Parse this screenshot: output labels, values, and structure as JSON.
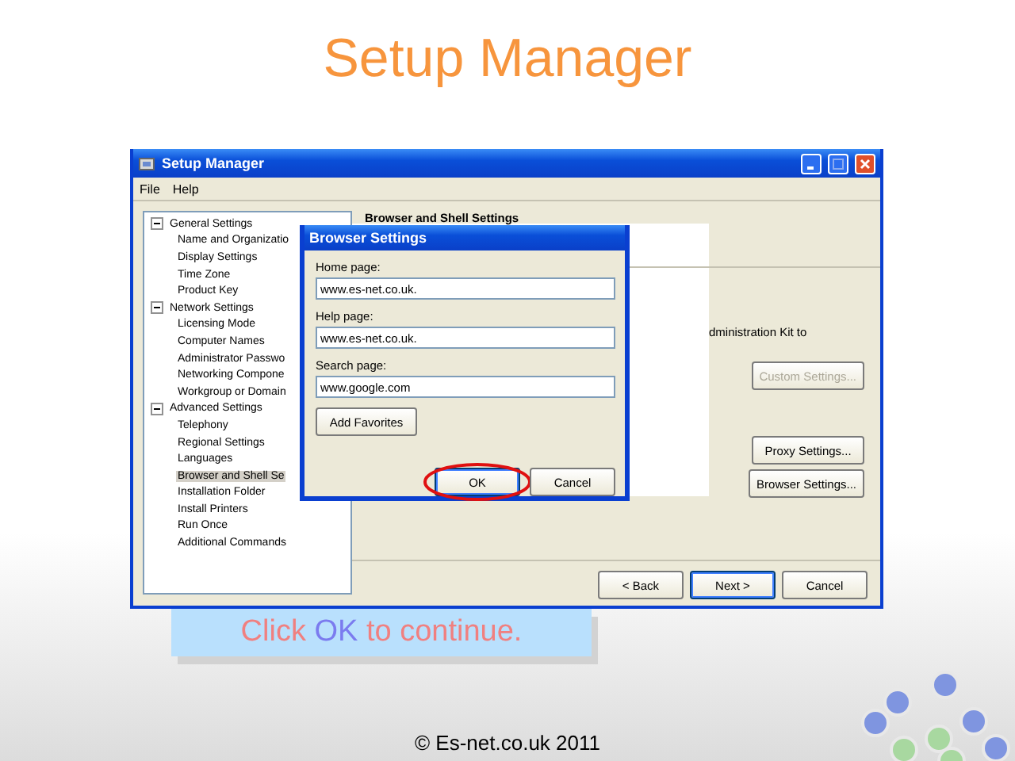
{
  "slide": {
    "title": "Setup Manager",
    "footer": "© Es-net.co.uk 2011"
  },
  "window": {
    "title": "Setup Manager",
    "menu": [
      "File",
      "Help"
    ],
    "tree": [
      {
        "label": "General Settings",
        "expanded": true,
        "selected": false,
        "children": [
          {
            "label": "Name and Organizatio",
            "selected": false
          },
          {
            "label": "Display Settings",
            "selected": false
          },
          {
            "label": "Time Zone",
            "selected": false
          },
          {
            "label": "Product Key",
            "selected": false
          }
        ]
      },
      {
        "label": "Network Settings",
        "expanded": true,
        "selected": false,
        "children": [
          {
            "label": "Licensing Mode",
            "selected": false
          },
          {
            "label": "Computer Names",
            "selected": false
          },
          {
            "label": "Administrator Passwo",
            "selected": false
          },
          {
            "label": "Networking Compone",
            "selected": false
          },
          {
            "label": "Workgroup or Domain",
            "selected": false
          }
        ]
      },
      {
        "label": "Advanced Settings",
        "expanded": true,
        "selected": false,
        "children": [
          {
            "label": "Telephony",
            "selected": false
          },
          {
            "label": "Regional Settings",
            "selected": false
          },
          {
            "label": "Languages",
            "selected": false
          },
          {
            "label": "Browser and Shell Se",
            "selected": true
          },
          {
            "label": "Installation Folder",
            "selected": false
          },
          {
            "label": "Install Printers",
            "selected": false
          },
          {
            "label": "Run Once",
            "selected": false
          },
          {
            "label": "Additional Commands",
            "selected": false
          }
        ]
      }
    ],
    "page_title": "Browser and Shell Settings",
    "text": "dministration Kit to",
    "buttons": [
      {
        "label": "Custom Settings...",
        "disabled": true
      },
      {
        "label": "Proxy Settings...",
        "disabled": false
      },
      {
        "label": "Browser Settings...",
        "disabled": false
      }
    ],
    "nav_buttons": [
      {
        "label": "< Back",
        "default": false
      },
      {
        "label": "Next >",
        "default": true
      },
      {
        "label": "Cancel",
        "default": false
      }
    ]
  },
  "dialog": {
    "title": "Browser Settings",
    "fields": [
      {
        "label": "Home page:",
        "value": "www.es-net.co.uk."
      },
      {
        "label": "Help page:",
        "value": "www.es-net.co.uk."
      },
      {
        "label": "Search page:",
        "value": "www.google.com"
      }
    ],
    "add_button": "Add Favorites",
    "buttons": [
      {
        "label": "OK",
        "highlighted": true
      },
      {
        "label": "Cancel",
        "highlighted": false
      }
    ]
  },
  "callout": {
    "before": "Click",
    "highlight": "OK",
    "after": "to continue."
  }
}
